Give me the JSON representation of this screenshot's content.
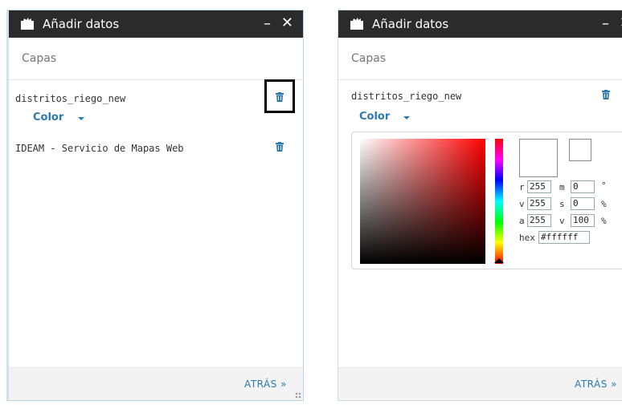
{
  "left_panel": {
    "title": "Añadir datos",
    "minimize": "–",
    "close": "✕",
    "section_title": "Capas",
    "layers": [
      {
        "name": "distritos_riego_new",
        "color_label": "Color"
      },
      {
        "name": "IDEAM - Servicio de Mapas Web"
      }
    ],
    "back_label": "ATRÁS »"
  },
  "right_panel": {
    "title": "Añadir datos",
    "minimize": "–",
    "close": "✕",
    "section_title": "Capas",
    "layers": [
      {
        "name": "distritos_riego_new",
        "color_label": "Color"
      }
    ],
    "color_picker": {
      "r": "255",
      "v_rgb": "255",
      "a": "255",
      "m": "0",
      "s": "0",
      "v_hsv": "100",
      "unit_m": "°",
      "unit_s": "%",
      "unit_v": "%",
      "labels": {
        "r": "r",
        "v_rgb": "v",
        "a": "a",
        "m": "m",
        "s": "s",
        "v_hsv": "v",
        "hex": "hex"
      },
      "hex": "#ffffff"
    },
    "back_label": "ATRÁS »"
  },
  "colors": {
    "accent": "#2a7ab0",
    "titlebar": "#2b2b2b"
  }
}
